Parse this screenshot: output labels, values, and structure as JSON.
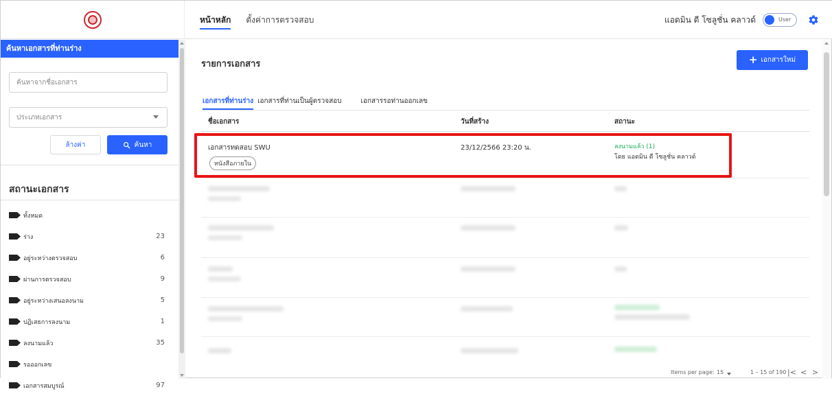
{
  "nav": {
    "home": "หน้าหลัก",
    "settings": "ตั้งค่าการตรวจสอบ"
  },
  "user": {
    "name": "แอดมิน ดี โซลูชั่น คลาวด์",
    "toggle_label": "User"
  },
  "sidebar": {
    "search_header": "ค้นหาเอกสารที่ท่านร่าง",
    "search_placeholder": "ค้นหาจากชื่อเอกสาร",
    "doc_type_placeholder": "ประเภทเอกสาร",
    "reset_label": "ล้างค่า",
    "search_label": "ค้นหา",
    "status_title": "สถานะเอกสาร",
    "status_items": [
      {
        "label": "ทั้งหมด",
        "count": ""
      },
      {
        "label": "ร่าง",
        "count": "23"
      },
      {
        "label": "อยู่ระหว่างตรวจสอบ",
        "count": "6"
      },
      {
        "label": "ผ่านการตรวจสอบ",
        "count": "9"
      },
      {
        "label": "อยู่ระหว่างเสนอลงนาม",
        "count": "5"
      },
      {
        "label": "ปฏิเสธการลงนาม",
        "count": "1"
      },
      {
        "label": "ลงนามแล้ว",
        "count": "35"
      },
      {
        "label": "รอออกเลข",
        "count": ""
      },
      {
        "label": "เอกสารสมบูรณ์",
        "count": "97"
      }
    ]
  },
  "main": {
    "title": "รายการเอกสาร",
    "new_button": "เอกสารใหม่",
    "tabs": [
      "เอกสารที่ท่านร่าง",
      "เอกสารที่ท่านเป็นผู้ตรวจสอบ",
      "เอกสารรอท่านออกเลข"
    ],
    "columns": [
      "ชื่อเอกสาร",
      "วันที่สร้าง",
      "สถานะ"
    ],
    "rows": [
      {
        "name": "เอกสารทดสอบ SWU",
        "chip": "หนังสือภายใน",
        "date": "23/12/2566 23:20 น.",
        "status": "ลงนามแล้ว (1)",
        "status_by": "โดย แอดมิน ดี โซลูชั่น คลาวด์"
      }
    ],
    "pager": {
      "items_per_page_label": "Items per page:",
      "items_per_page": "15",
      "range": "1 – 15 of 190"
    }
  },
  "colors": {
    "primary": "#2962ff",
    "highlight": "#e81414",
    "success": "#1aaa55"
  }
}
